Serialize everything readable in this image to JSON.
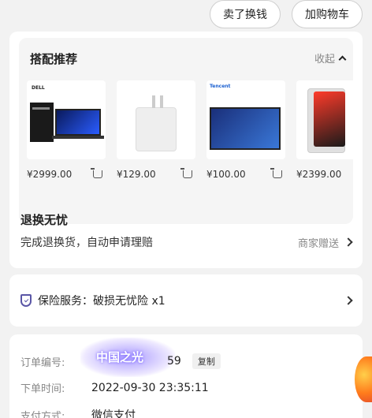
{
  "top_actions": {
    "sell_label": "卖了换钱",
    "cart_label": "加购物车"
  },
  "recommendations": {
    "title": "搭配推荐",
    "toggle_label": "收起",
    "items": [
      {
        "price": "¥2999.00",
        "image": "laptop",
        "brand": "DELL"
      },
      {
        "price": "¥129.00",
        "image": "charger"
      },
      {
        "price": "¥100.00",
        "image": "drawing-board",
        "brand": "Tencent"
      },
      {
        "price": "¥2399.00",
        "image": "tablet"
      }
    ]
  },
  "return_service": {
    "title": "退换无忧",
    "desc": "完成退换货，自动申请理赔",
    "badge": "商家赠送"
  },
  "insurance": {
    "label": "保险服务：破损无忧险 x1"
  },
  "order_info": {
    "order_number_label": "订单编号:",
    "order_number_value": "59",
    "copy_label": "复制",
    "order_time_label": "下单时间:",
    "order_time_value": "2022-09-30 23:35:11",
    "payment_label": "支付方式:",
    "payment_value": "微信支付",
    "watermark": "中国之光"
  },
  "colors": {
    "accent_purple": "#5a56a6",
    "background": "#f2f2f2",
    "card": "#ffffff"
  }
}
